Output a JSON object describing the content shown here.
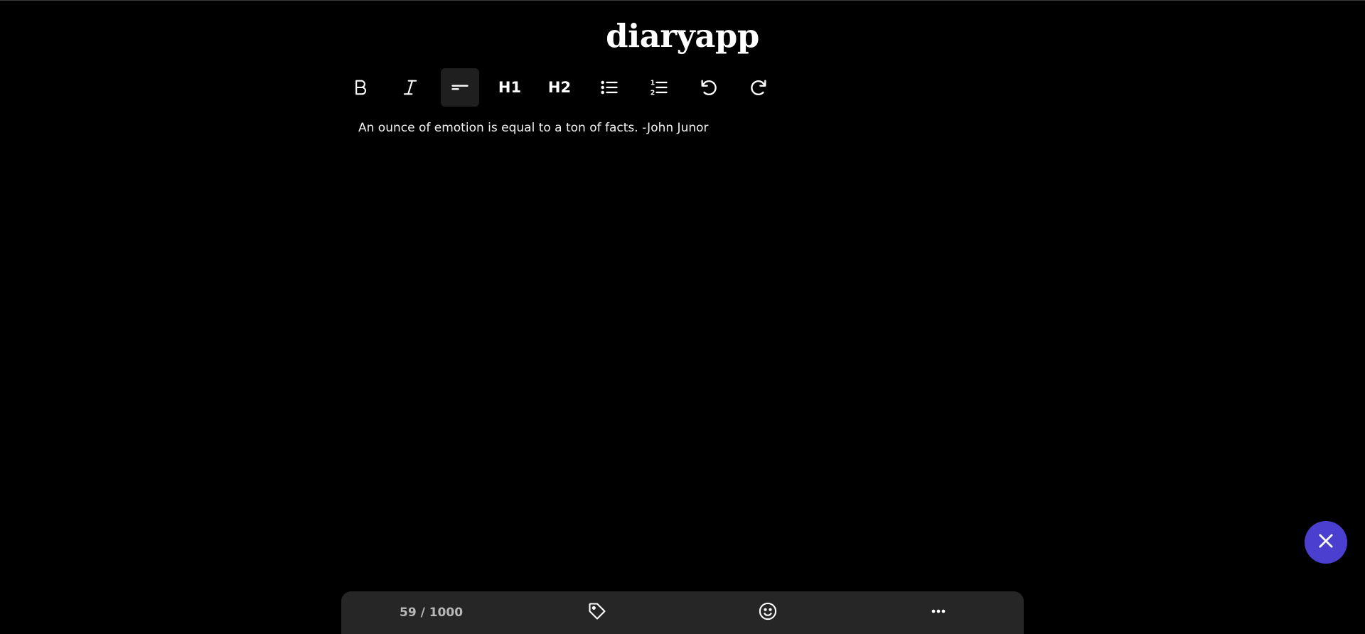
{
  "app": {
    "title": "diaryapp"
  },
  "toolbar": {
    "items": [
      {
        "name": "bold",
        "icon": "bold-icon"
      },
      {
        "name": "italic",
        "icon": "italic-icon"
      },
      {
        "name": "paragraph",
        "icon": "paragraph-icon",
        "active": true
      },
      {
        "name": "heading1",
        "label": "H1"
      },
      {
        "name": "heading2",
        "label": "H2"
      },
      {
        "name": "bullet-list",
        "icon": "bullet-list-icon"
      },
      {
        "name": "numbered-list",
        "icon": "numbered-list-icon"
      },
      {
        "name": "undo",
        "icon": "undo-icon"
      },
      {
        "name": "redo",
        "icon": "redo-icon"
      }
    ]
  },
  "editor": {
    "content": "An ounce of emotion is equal to a ton of facts. -John Junor"
  },
  "footer": {
    "char_count": "59 / 1000",
    "icons": [
      "tag-icon",
      "emoji-icon",
      "more-icon"
    ]
  },
  "fab": {
    "icon": "close-icon"
  },
  "colors": {
    "background": "#000000",
    "toolbar_active": "#1f1f1f",
    "fab": "#4b3fcf",
    "bottom_bar": "#262626",
    "counter_text": "#b8b8b8"
  }
}
